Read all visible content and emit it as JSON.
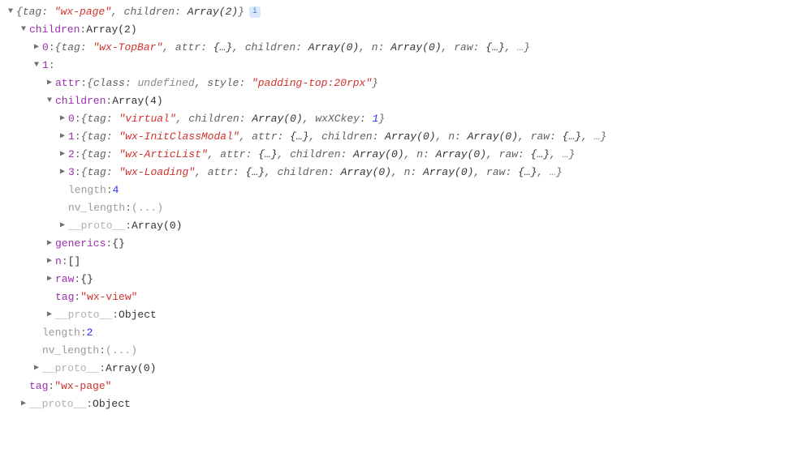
{
  "glyph": {
    "down": "▼",
    "right": "▶",
    "info": "i"
  },
  "labels": {
    "tag": "tag",
    "children": "children",
    "attr": "attr",
    "class": "class",
    "style": "style",
    "generics": "generics",
    "n": "n",
    "raw": "raw",
    "length": "length",
    "nv_length": "nv_length",
    "proto": "__proto__",
    "wxXCkey": "wxXCkey",
    "undefined": "undefined"
  },
  "preview": {
    "array2": "Array(2)",
    "array4": "Array(4)",
    "array0": "Array(0)",
    "object": "Object",
    "braceEllipsis": "{…}",
    "ellipsis": "…",
    "dots": "(...)",
    "emptyObj": "{}",
    "emptyArr": "[]"
  },
  "root": {
    "tagVal": "\"wx-page\""
  },
  "child0": {
    "tagVal": "\"wx-TopBar\""
  },
  "child1": {
    "styleVal": "\"padding-top:20rpx\"",
    "tagVal": "\"wx-view\""
  },
  "gchild": {
    "g0": {
      "tagVal": "\"virtual\"",
      "wxXCkeyVal": "1"
    },
    "g1": {
      "tagVal": "\"wx-InitClassModal\""
    },
    "g2": {
      "tagVal": "\"wx-ArticList\""
    },
    "g3": {
      "tagVal": "\"wx-Loading\""
    },
    "lengthVal": "4"
  },
  "rootChildrenLen": "2"
}
